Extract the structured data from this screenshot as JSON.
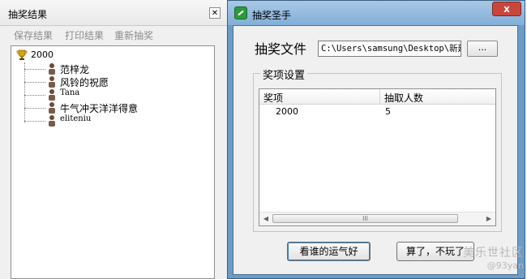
{
  "results_window": {
    "title": "抽奖结果",
    "close_glyph": "✕",
    "menu": [
      "保存结果",
      "打印结果",
      "重新抽奖"
    ],
    "tree": {
      "root": "2000",
      "items": [
        "范梓龙",
        "风铃的祝愿",
        "Tana",
        "牛气冲天洋洋得意",
        "eliteniu"
      ]
    }
  },
  "main_window": {
    "title": "抽奖圣手",
    "close_glyph": "x",
    "file_label": "抽奖文件",
    "file_path": "C:\\Users\\samsung\\Desktop\\新建",
    "browse_label": "...",
    "prize_group_title": "奖项设置",
    "columns": [
      "奖项",
      "抽取人数"
    ],
    "rows": [
      {
        "prize": "2000",
        "count": "5"
      }
    ],
    "scrollbar_grip": "III",
    "draw_button": "看谁的运气好",
    "quit_button": "算了，不玩了"
  },
  "watermark": {
    "line1": "美乐世社区",
    "line2": "@93yan"
  },
  "colors": {
    "title_bar": "#82aed7",
    "app_icon": "#2c9a3c",
    "close_button": "#c9463d"
  }
}
